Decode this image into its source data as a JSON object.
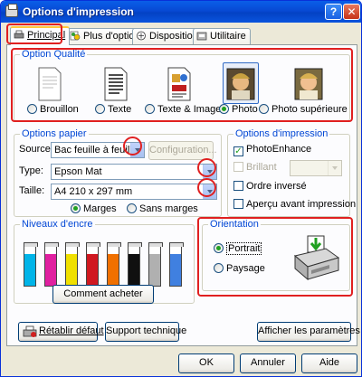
{
  "window": {
    "title": "Options d'impression",
    "help_glyph": "?",
    "close_glyph": "✕"
  },
  "tabs": [
    {
      "label": "Principal",
      "icon": "printer-icon",
      "active": true
    },
    {
      "label": "Plus d'options",
      "icon": "options-icon",
      "active": false
    },
    {
      "label": "Disposition",
      "icon": "layout-icon",
      "active": false
    },
    {
      "label": "Utilitaire",
      "icon": "utility-icon",
      "active": false
    }
  ],
  "quality": {
    "label": "Option Qualité",
    "options": [
      {
        "label": "Brouillon",
        "icon": "draft-doc-icon",
        "selected": false
      },
      {
        "label": "Texte",
        "icon": "text-doc-icon",
        "selected": false
      },
      {
        "label": "Texte & Image",
        "icon": "text-image-doc-icon",
        "selected": false
      },
      {
        "label": "Photo",
        "icon": "photo-icon",
        "selected": true
      },
      {
        "label": "Photo supérieure",
        "icon": "photo-superior-icon",
        "selected": false
      }
    ]
  },
  "paper": {
    "label": "Options papier",
    "source_label": "Source:",
    "source_value": "Bac feuille à feuille",
    "config_button": "Configuration...",
    "type_label": "Type:",
    "type_value": "Epson Mat",
    "size_label": "Taille:",
    "size_value": "A4 210 x 297 mm",
    "margins_label": "Marges",
    "no_margins_label": "Sans marges",
    "margins_selected": true
  },
  "print_options": {
    "label": "Options d'impression",
    "photo_enhance": "PhotoEnhance",
    "photo_enhance_checked": true,
    "brilliant": "Brillant",
    "mirror": "Ordre inversé",
    "preview": "Aperçu avant impression"
  },
  "ink": {
    "label": "Niveaux d'encre",
    "cartridges": [
      {
        "color": "#00B4E8",
        "level": 0.8
      },
      {
        "color": "#E020A0",
        "level": 0.8
      },
      {
        "color": "#F0E000",
        "level": 0.8
      },
      {
        "color": "#D01820",
        "level": 0.8
      },
      {
        "color": "#F07000",
        "level": 0.8
      },
      {
        "color": "#101010",
        "level": 0.8
      },
      {
        "color": "#B0B0B0",
        "level": 0.8
      },
      {
        "color": "#4080E0",
        "level": 0.8
      }
    ],
    "buy_button": "Comment acheter"
  },
  "orientation": {
    "label": "Orientation",
    "portrait": "Portrait",
    "landscape": "Paysage",
    "portrait_selected": true
  },
  "footer": {
    "restore_defaults": "Rétablir défaut",
    "tech_support": "Support technique",
    "show_settings": "Afficher les paramètres",
    "ok": "OK",
    "cancel": "Annuler",
    "help": "Aide"
  },
  "colors": {
    "highlight": "#E02020",
    "group_title": "#0046D5",
    "titlebar": "#0749D4"
  }
}
